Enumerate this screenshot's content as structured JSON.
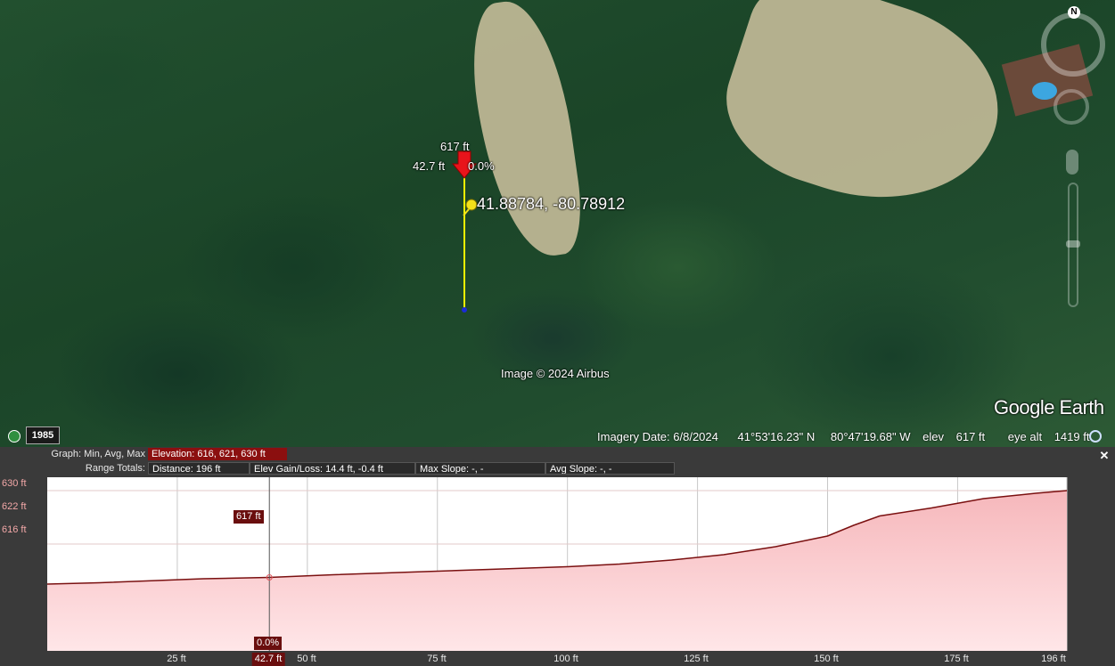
{
  "map": {
    "marker_elevation": "617 ft",
    "marker_distance": "42.7 ft",
    "marker_slope": "0.0%",
    "pin_coords": "41.88784, -80.78912",
    "copyright": "Image © 2024 Airbus",
    "brand": "Google Earth",
    "compass_n": "N",
    "year_badge": "1985"
  },
  "status": {
    "imagery_date": "Imagery Date: 6/8/2024",
    "lat": "41°53'16.23\" N",
    "lon": "80°47'19.68\" W",
    "elev_label": "elev",
    "elev_value": "617 ft",
    "eye_label": "eye alt",
    "eye_value": "1419 ft"
  },
  "profile": {
    "graph_label": "Graph: Min, Avg, Max",
    "elevation": "Elevation: 616, 621, 630 ft",
    "range_label": "Range Totals:",
    "distance": "Distance: 196 ft",
    "gain_loss": "Elev Gain/Loss: 14.4 ft, -0.4 ft",
    "max_slope": "Max Slope: -, -",
    "avg_slope": "Avg Slope: -, -",
    "cursor_value": "617 ft",
    "cursor_slope": "0.0%",
    "cursor_x_label": "42.7 ft",
    "y_ticks": [
      "630 ft",
      "622 ft",
      "616 ft"
    ],
    "x_ticks": [
      "25 ft",
      "50 ft",
      "75 ft",
      "100 ft",
      "125 ft",
      "150 ft",
      "175 ft",
      "196 ft"
    ],
    "close_glyph": "✕"
  },
  "colors": {
    "highlight_box": "#8b0f0f",
    "field_box": "#2a2a2a",
    "profile_line": "#7a1010",
    "fill_top": "#f6b7bb",
    "fill_bottom": "#ffe6e8"
  },
  "chart_data": {
    "type": "area",
    "x": [
      0,
      10,
      20,
      30,
      42.7,
      55,
      70,
      85,
      100,
      110,
      120,
      130,
      140,
      145,
      150,
      155,
      160,
      170,
      180,
      190,
      196
    ],
    "values": [
      616,
      616.2,
      616.5,
      616.8,
      617,
      617.4,
      617.8,
      618.2,
      618.6,
      619,
      619.6,
      620.4,
      621.6,
      622.4,
      623.2,
      624.8,
      626.2,
      627.4,
      628.8,
      629.6,
      630
    ],
    "xlim": [
      0,
      196
    ],
    "ylim": [
      606,
      632
    ],
    "x_ticks": [
      25,
      50,
      75,
      100,
      125,
      150,
      175,
      196
    ],
    "y_ticks": [
      630,
      622,
      616
    ],
    "cursor_x": 42.7,
    "grid": true
  }
}
